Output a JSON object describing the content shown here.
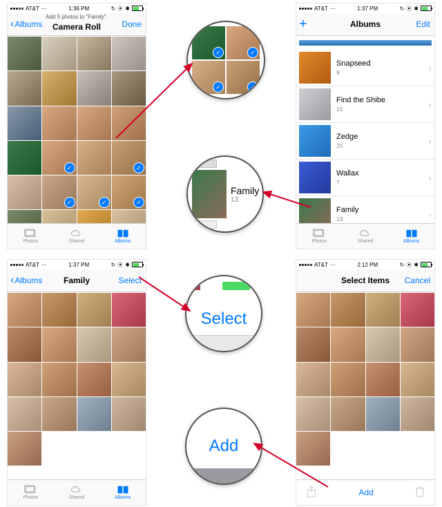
{
  "status": {
    "carrier": "AT&T",
    "time1": "1:36 PM",
    "time2": "1:37 PM",
    "time3": "1:37 PM",
    "time4": "2:12 PM"
  },
  "p1": {
    "subtitle": "Add 5 photos to \"Family\".",
    "back": "Albums",
    "title": "Camera Roll",
    "done": "Done",
    "selected": [
      13,
      15,
      17,
      18,
      19
    ]
  },
  "p2": {
    "title": "Albums",
    "edit": "Edit",
    "albums": [
      {
        "name": "Snapseed",
        "count": "9",
        "c1": "#e08a2a",
        "c2": "#b35a10"
      },
      {
        "name": "Find the Shibe",
        "count": "15",
        "c1": "#cfcfd4",
        "c2": "#9a9aa0"
      },
      {
        "name": "Zedge",
        "count": "25",
        "c1": "#3a9be8",
        "c2": "#1f6bb8"
      },
      {
        "name": "Wallax",
        "count": "7",
        "c1": "#3a5bd8",
        "c2": "#223a98"
      },
      {
        "name": "Family",
        "count": "13",
        "c1": "#3a7a4a",
        "c2": "#8a6a5a"
      }
    ]
  },
  "p3": {
    "back": "Albums",
    "title": "Family",
    "select": "Select"
  },
  "p4": {
    "title": "Select Items",
    "cancel": "Cancel",
    "add": "Add"
  },
  "tabs": {
    "photos": "Photos",
    "shared": "Shared",
    "albums": "Albums"
  },
  "mag": {
    "select": "Select",
    "add": "Add",
    "family": "Family",
    "familyCount": "13"
  },
  "thumbColors": [
    [
      "#7a8a6a",
      "#4a5a3a"
    ],
    [
      "#d8d0c0",
      "#a89880"
    ],
    [
      "#c8b8a0",
      "#887860"
    ],
    [
      "#d0c8c0",
      "#989088"
    ],
    [
      "#b8a890",
      "#786850"
    ],
    [
      "#d8b070",
      "#a07830"
    ],
    [
      "#c8c0b8",
      "#888078"
    ],
    [
      "#a89880",
      "#685840"
    ],
    [
      "#8898a8",
      "#486078"
    ],
    [
      "#d8a880",
      "#a87850"
    ],
    [
      "#d8a880",
      "#a87850"
    ],
    [
      "#d0a078",
      "#a07048"
    ],
    [
      "#3a7a4a",
      "#1a5a2a"
    ],
    [
      "#d8a880",
      "#a87850"
    ],
    [
      "#d8b088",
      "#a88058"
    ],
    [
      "#c8a078",
      "#987048"
    ],
    [
      "#d8c0a8",
      "#a89078"
    ],
    [
      "#c8a888",
      "#987858"
    ],
    [
      "#d8b890",
      "#a88860"
    ],
    [
      "#d0a878",
      "#a07848"
    ],
    [
      "#7a8a6a",
      "#4a5a3a"
    ],
    [
      "#d8c098",
      "#a89068"
    ],
    [
      "#e0a850",
      "#b07820"
    ],
    [
      "#d8c0a0",
      "#a89070"
    ]
  ],
  "familyThumbs": [
    [
      "#d8a880",
      "#a87850"
    ],
    [
      "#c89868",
      "#986838"
    ],
    [
      "#d0b080",
      "#a08050"
    ],
    [
      "#d86878",
      "#a83848"
    ],
    [
      "#b88868",
      "#885838"
    ],
    [
      "#d8a880",
      "#a87850"
    ],
    [
      "#d8c8b0",
      "#a89880"
    ],
    [
      "#d0a888",
      "#a07858"
    ],
    [
      "#d8b898",
      "#a88868"
    ],
    [
      "#d0a078",
      "#a07048"
    ],
    [
      "#c89070",
      "#986040"
    ],
    [
      "#d8b890",
      "#a88860"
    ],
    [
      "#d8c0a8",
      "#a89078"
    ],
    [
      "#c8a888",
      "#987858"
    ],
    [
      "#a0b0c0",
      "#708090"
    ],
    [
      "#d0b8a0",
      "#a08870"
    ],
    [
      "#c8a080",
      "#986850"
    ]
  ]
}
